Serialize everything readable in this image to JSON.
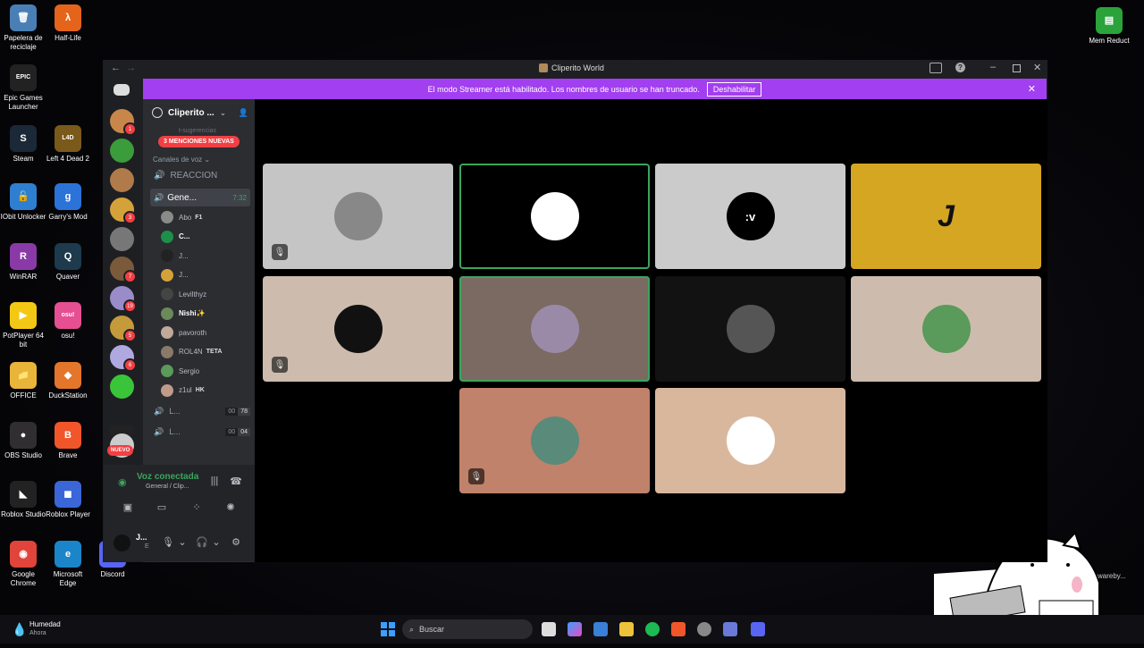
{
  "desktop": {
    "left_icons": [
      {
        "label": "Papelera de reciclaje",
        "glyph": "🗑",
        "color": "#4a7fb5"
      },
      {
        "label": "Half-Life",
        "glyph": "λ",
        "color": "#e3641a"
      },
      {
        "label": "Epic Games Launcher",
        "glyph": "EPIC",
        "color": "#222"
      },
      {
        "label": "Steam",
        "glyph": "S",
        "color": "#1b2838"
      },
      {
        "label": "Left 4 Dead 2",
        "glyph": "L4D",
        "color": "#7a5a1a"
      },
      {
        "label": "IObit Unlocker",
        "glyph": "🔓",
        "color": "#2f7fd1"
      },
      {
        "label": "Garry's Mod",
        "glyph": "g",
        "color": "#2b73d8"
      },
      {
        "label": "WinRAR",
        "glyph": "R",
        "color": "#8a3aa6"
      },
      {
        "label": "Quaver",
        "glyph": "Q",
        "color": "#1e3a4d"
      },
      {
        "label": "PotPlayer 64 bit",
        "glyph": "▶",
        "color": "#f3c814"
      },
      {
        "label": "osu!",
        "glyph": "osu!",
        "color": "#e64f92"
      },
      {
        "label": "OFFICE",
        "glyph": "📁",
        "color": "#e8b53a"
      },
      {
        "label": "DuckStation",
        "glyph": "◆",
        "color": "#e3762a"
      },
      {
        "label": "OBS Studio",
        "glyph": "●",
        "color": "#302e31"
      },
      {
        "label": "Brave",
        "glyph": "B",
        "color": "#f1562a"
      },
      {
        "label": "Roblox Studio",
        "glyph": "◣",
        "color": "#222"
      },
      {
        "label": "Roblox Player",
        "glyph": "◼",
        "color": "#3b66d8"
      },
      {
        "label": "Google Chrome",
        "glyph": "◉",
        "color": "#e0443a"
      },
      {
        "label": "Microsoft Edge",
        "glyph": "e",
        "color": "#1a86c9"
      },
      {
        "label": "Discord",
        "glyph": "D",
        "color": "#5865f2"
      }
    ],
    "right_icon": {
      "label": "Mem Reduct",
      "glyph": "▤",
      "color": "#2aa33b"
    },
    "partial_label": "wareby..."
  },
  "window": {
    "title": "Cliperito World",
    "banner": {
      "message": "El modo Streamer está habilitado. Los nombres de usuario se han truncado.",
      "button": "Deshabilitar"
    }
  },
  "servers": [
    {
      "color": "#c8864a",
      "badge": "1"
    },
    {
      "color": "#3a9c3a",
      "badge": ""
    },
    {
      "color": "#b07a4a",
      "badge": ""
    },
    {
      "color": "#d4a23a",
      "badge": "3"
    },
    {
      "color": "#777",
      "badge": ""
    },
    {
      "color": "#7a5a3a",
      "badge": "7"
    },
    {
      "color": "#9a8cc8",
      "badge": "19"
    },
    {
      "color": "#c49a3a",
      "badge": "5"
    },
    {
      "color": "#b0a8e0",
      "badge": "6"
    },
    {
      "color": "#3ac43a",
      "badge": ""
    },
    {
      "color": "#222",
      "badge": ""
    },
    {
      "color": "#ccc",
      "badge": ""
    }
  ],
  "server_new_label": "NUEVO",
  "channel_sidebar": {
    "server_name": "Cliperito ...",
    "mentions_pill": "3 MENCIONES NUEVAS",
    "hidden_channel": "t-sugerencias",
    "category": "Canales de voz",
    "channels": [
      {
        "name": "REACCION"
      },
      {
        "name": "Gene...",
        "timer": "7:32"
      }
    ],
    "voice_users": [
      {
        "name": "Abo",
        "tag": "F1",
        "color": "#8a8a8a"
      },
      {
        "name": "C...",
        "tag": "",
        "color": "#1e8f4a"
      },
      {
        "name": "J...",
        "tag": "",
        "color": "#222"
      },
      {
        "name": "J...",
        "tag": "",
        "color": "#d4a23a"
      },
      {
        "name": "Levilthyz",
        "tag": "",
        "color": "#444"
      },
      {
        "name": "Nishi✨",
        "tag": "",
        "color": "#6a8a5a"
      },
      {
        "name": "pavoroth",
        "tag": "",
        "color": "#c0a89a"
      },
      {
        "name": "ROL4N",
        "tag": "TETA",
        "color": "#8a7a6a"
      },
      {
        "name": "Sergio",
        "tag": "",
        "color": "#5a9a5a"
      },
      {
        "name": "z1ul",
        "tag": "HK",
        "color": "#c09a8a"
      }
    ],
    "other_channels": [
      {
        "name": "L...",
        "count1": "00",
        "count2": "78"
      },
      {
        "name": "L...",
        "count1": "00",
        "count2": "04"
      }
    ]
  },
  "voice_panel": {
    "status": "Voz conectada",
    "channel": "General / Clip..."
  },
  "user_panel": {
    "name": "J...",
    "status": "E"
  },
  "tiles": [
    {
      "bg": "#c5c5c5",
      "av": "#888",
      "label": "",
      "muted": true,
      "speaking": false
    },
    {
      "bg": "#000",
      "av": "#fff",
      "label": "",
      "muted": false,
      "speaking": true
    },
    {
      "bg": "#cbcbcb",
      "av": "#000",
      "label": ":v",
      "muted": false,
      "speaking": false
    },
    {
      "bg": "#d4a622",
      "av": "#d4a622",
      "label": "J",
      "muted": false,
      "speaking": false
    },
    {
      "bg": "#cdbcad",
      "av": "#111",
      "label": "",
      "muted": true,
      "speaking": false
    },
    {
      "bg": "#7b6a62",
      "av": "#9a8aa8",
      "label": "",
      "muted": false,
      "speaking": true
    },
    {
      "bg": "#121212",
      "av": "#555",
      "label": "",
      "muted": false,
      "speaking": false
    },
    {
      "bg": "#cdbcad",
      "av": "#5a9a5a",
      "label": "",
      "muted": false,
      "speaking": false
    },
    {
      "bg": "#c0826a",
      "av": "#5a8a7a",
      "label": "",
      "muted": true,
      "speaking": false
    },
    {
      "bg": "#d9b79d",
      "av": "#fff",
      "label": "",
      "muted": false,
      "speaking": false
    }
  ],
  "taskbar": {
    "weather_title": "Humedad",
    "weather_sub": "Ahora",
    "search_placeholder": "Buscar"
  }
}
